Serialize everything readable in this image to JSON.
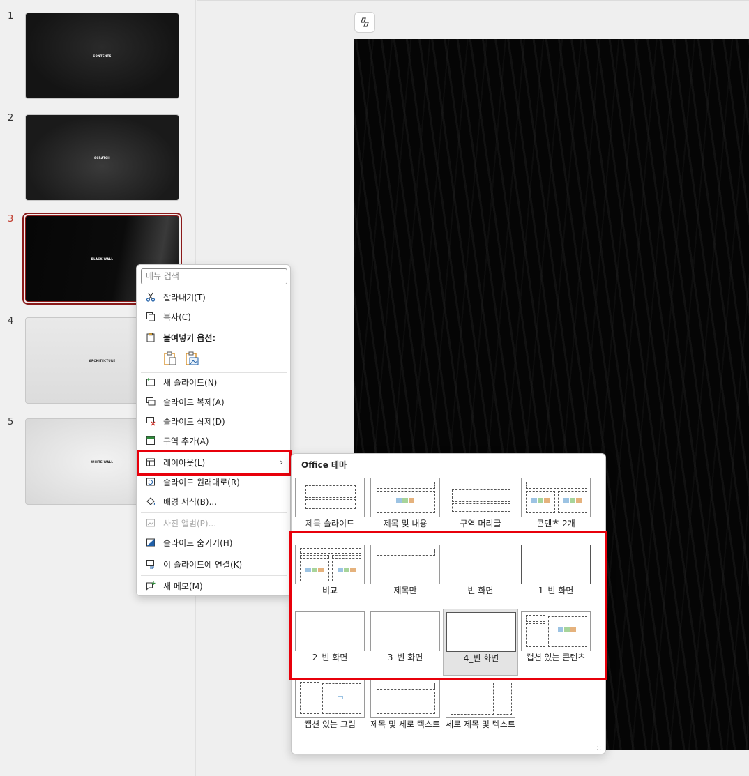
{
  "thumbnails": [
    {
      "num": "1",
      "title": "CONTENTS"
    },
    {
      "num": "2",
      "title": "SCRATCH"
    },
    {
      "num": "3",
      "title": "BLACK WALL"
    },
    {
      "num": "4",
      "title": "ARCHITECTURE"
    },
    {
      "num": "5",
      "title": "WHITE WALL"
    }
  ],
  "context_menu": {
    "search_placeholder": "메뉴 검색",
    "items": {
      "cut": "잘라내기(T)",
      "copy": "복사(C)",
      "paste_options": "붙여넣기 옵션:",
      "new_slide": "새 슬라이드(N)",
      "duplicate_slide": "슬라이드 복제(A)",
      "delete_slide": "슬라이드 삭제(D)",
      "add_section": "구역 추가(A)",
      "layout": "레이아웃(L)",
      "reset_slide": "슬라이드 원래대로(R)",
      "format_background": "배경 서식(B)...",
      "photo_album": "사진 앨범(P)...",
      "hide_slide": "슬라이드 숨기기(H)",
      "link_to_slide": "이 슬라이드에 연결(K)",
      "new_comment": "새 메모(M)"
    }
  },
  "layout_menu": {
    "title": "Office 테마",
    "layouts": [
      "제목 슬라이드",
      "제목 및 내용",
      "구역 머리글",
      "콘텐츠 2개",
      "비교",
      "제목만",
      "빈 화면",
      "1_빈 화면",
      "2_빈 화면",
      "3_빈 화면",
      "4_빈 화면",
      "캡션 있는 콘텐츠",
      "캡션 있는 그림",
      "제목 및 세로 텍스트",
      "세로 제목 및 텍스트"
    ],
    "selected": "4_빈 화면"
  },
  "colors": {
    "highlight_red": "#e8000b",
    "selected_thumb": "#8b1a1a"
  }
}
